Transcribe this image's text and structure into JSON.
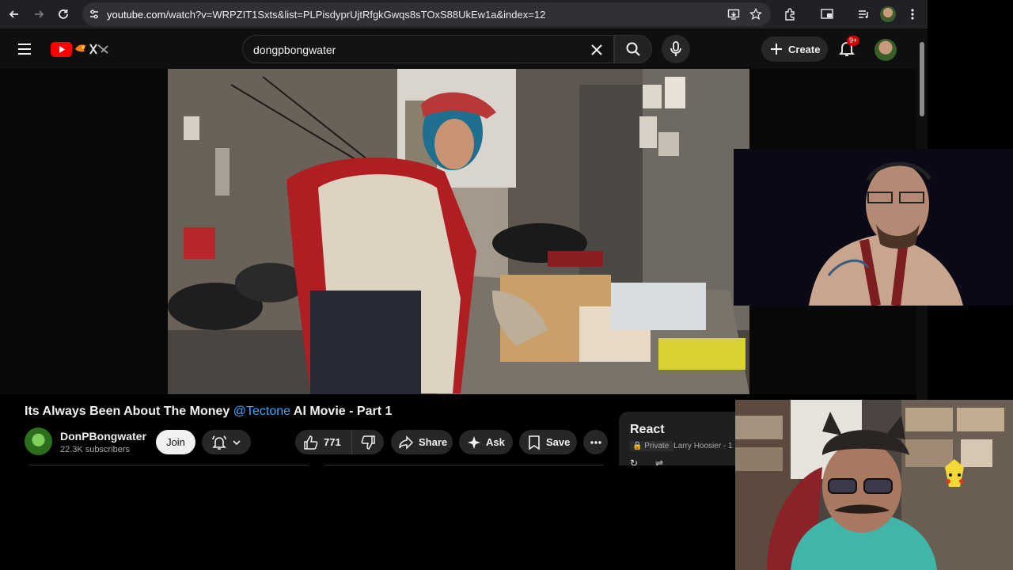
{
  "browser": {
    "url_host": "youtube.com",
    "url_path": "/watch?v=WRPZIT1Sxts&list=PLPisdyprUjtRfgkGwqs8sTOxS88UkEw1a&index=12"
  },
  "masthead": {
    "search_query": "dongpbongwater",
    "create_label": "Create",
    "notification_badge": "9+"
  },
  "video": {
    "title_pre": "Its Always Been About The Money ",
    "title_tag": "@Tectone",
    "title_post": " AI Movie - Part 1"
  },
  "channel": {
    "name": "DonPBongwater",
    "subscribers": "22.3K subscribers",
    "join_label": "Join"
  },
  "actions": {
    "likes": "771",
    "share": "Share",
    "ask": "Ask",
    "save": "Save"
  },
  "react_panel": {
    "heading": "React",
    "private_label": "Private",
    "owner": "Larry Hoosier - 1"
  },
  "colors": {
    "accent_link": "#3ea6ff",
    "youtube_red": "#ff0000",
    "badge_red": "#cc0000"
  }
}
